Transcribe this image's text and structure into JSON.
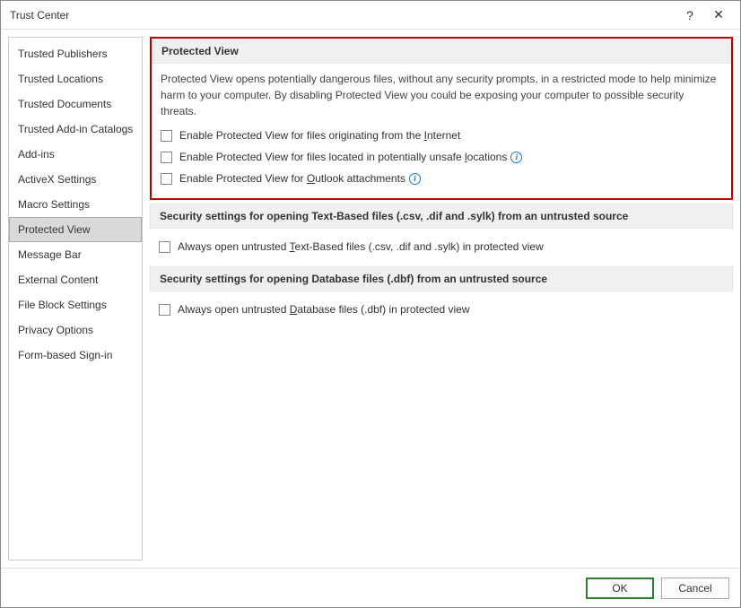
{
  "window": {
    "title": "Trust Center"
  },
  "sidebar": {
    "items": [
      {
        "label": "Trusted Publishers"
      },
      {
        "label": "Trusted Locations"
      },
      {
        "label": "Trusted Documents"
      },
      {
        "label": "Trusted Add-in Catalogs"
      },
      {
        "label": "Add-ins"
      },
      {
        "label": "ActiveX Settings"
      },
      {
        "label": "Macro Settings"
      },
      {
        "label": "Protected View",
        "selected": true
      },
      {
        "label": "Message Bar"
      },
      {
        "label": "External Content"
      },
      {
        "label": "File Block Settings"
      },
      {
        "label": "Privacy Options"
      },
      {
        "label": "Form-based Sign-in"
      }
    ]
  },
  "sections": {
    "protected_view": {
      "heading": "Protected View",
      "description": "Protected View opens potentially dangerous files, without any security prompts, in a restricted mode to help minimize harm to your computer. By disabling Protected View you could be exposing your computer to possible security threats.",
      "options": [
        {
          "label_pre": "Enable Protected View for files originating from the ",
          "u": "I",
          "label_post": "nternet",
          "info": false
        },
        {
          "label_pre": "Enable Protected View for files located in potentially unsafe ",
          "u": "l",
          "label_post": "ocations",
          "info": true
        },
        {
          "label_pre": "Enable Protected View for ",
          "u": "O",
          "label_post": "utlook attachments",
          "info": true
        }
      ]
    },
    "text_based": {
      "heading": "Security settings for opening Text-Based files (.csv, .dif and .sylk) from an untrusted source",
      "option": {
        "label_pre": "Always open untrusted ",
        "u": "T",
        "label_post": "ext-Based files (.csv, .dif and .sylk) in protected view"
      }
    },
    "database": {
      "heading": "Security settings for opening Database files (.dbf) from an untrusted source",
      "option": {
        "label_pre": "Always open untrusted ",
        "u": "D",
        "label_post": "atabase files (.dbf) in protected view"
      }
    }
  },
  "footer": {
    "ok": "OK",
    "cancel": "Cancel"
  },
  "icons": {
    "help": "?",
    "close": "✕",
    "info": "i"
  }
}
